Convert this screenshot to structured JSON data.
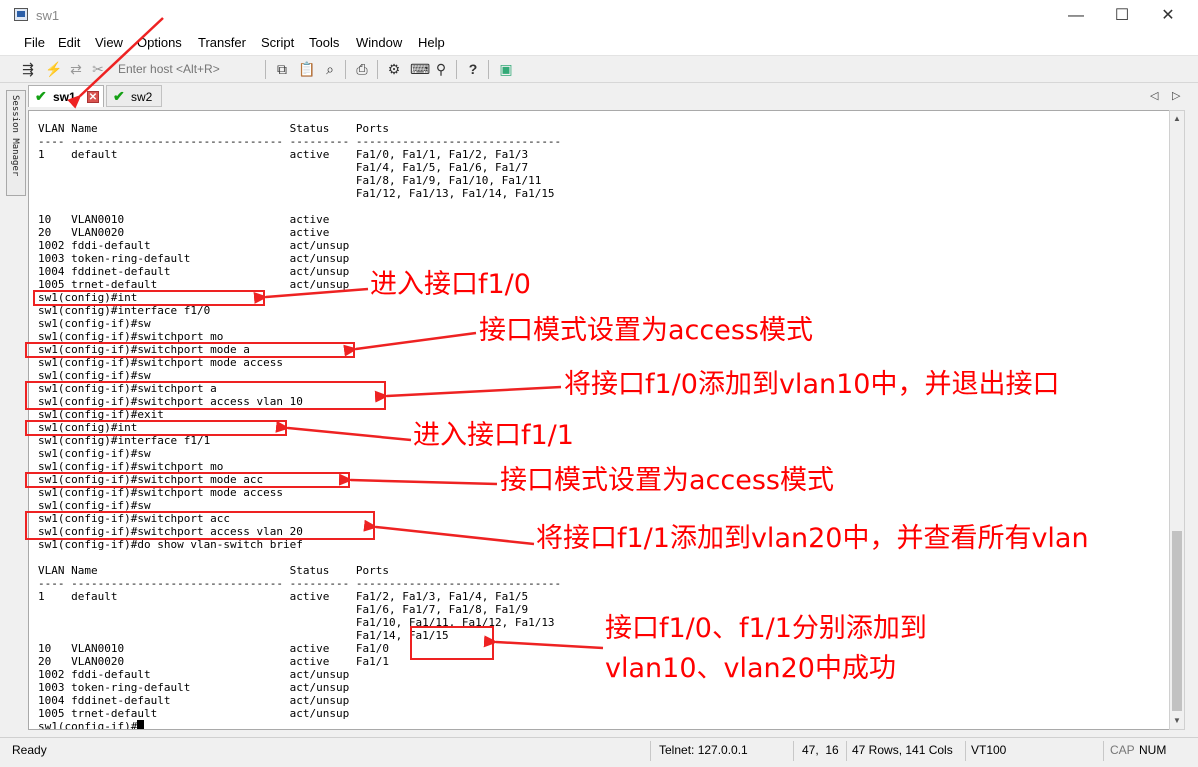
{
  "window": {
    "title": "sw1",
    "minimize": "—",
    "maximize": "☐",
    "close": "✕"
  },
  "menu": [
    "File",
    "Edit",
    "View",
    "Options",
    "Transfer",
    "Script",
    "Tools",
    "Window",
    "Help"
  ],
  "toolbar": {
    "host_placeholder": "Enter host <Alt+R>",
    "icons": [
      "connect-icon",
      "quick-connect-icon",
      "reconnect-icon",
      "disconnect-icon",
      "copy-icon",
      "paste-icon",
      "find-icon",
      "print-icon",
      "settings-icon",
      "keymap-icon",
      "sftp-icon",
      "help-icon",
      "log-icon"
    ]
  },
  "sidebar": {
    "label": "Session Manager"
  },
  "tabs": [
    {
      "label": "sw1",
      "active": true
    },
    {
      "label": "sw2",
      "active": false
    }
  ],
  "terminal": {
    "text": "VLAN Name                             Status    Ports\n---- -------------------------------- --------- -------------------------------\n1    default                          active    Fa1/0, Fa1/1, Fa1/2, Fa1/3\n                                                Fa1/4, Fa1/5, Fa1/6, Fa1/7\n                                                Fa1/8, Fa1/9, Fa1/10, Fa1/11\n                                                Fa1/12, Fa1/13, Fa1/14, Fa1/15\n\n10   VLAN0010                         active\n20   VLAN0020                         active\n1002 fddi-default                     act/unsup\n1003 token-ring-default               act/unsup\n1004 fddinet-default                  act/unsup\n1005 trnet-default                    act/unsup\nsw1(config)#int\nsw1(config)#interface f1/0\nsw1(config-if)#sw\nsw1(config-if)#switchport mo\nsw1(config-if)#switchport mode a\nsw1(config-if)#switchport mode access\nsw1(config-if)#sw\nsw1(config-if)#switchport a\nsw1(config-if)#switchport access vlan 10\nsw1(config-if)#exit\nsw1(config)#int\nsw1(config)#interface f1/1\nsw1(config-if)#sw\nsw1(config-if)#switchport mo\nsw1(config-if)#switchport mode acc\nsw1(config-if)#switchport mode access\nsw1(config-if)#sw\nsw1(config-if)#switchport acc\nsw1(config-if)#switchport access vlan 20\nsw1(config-if)#do show vlan-switch brief\n\nVLAN Name                             Status    Ports\n---- -------------------------------- --------- -------------------------------\n1    default                          active    Fa1/2, Fa1/3, Fa1/4, Fa1/5\n                                                Fa1/6, Fa1/7, Fa1/8, Fa1/9\n                                                Fa1/10, Fa1/11, Fa1/12, Fa1/13\n                                                Fa1/14, Fa1/15\n10   VLAN0010                         active    Fa1/0\n20   VLAN0020                         active    Fa1/1\n1002 fddi-default                     act/unsup\n1003 token-ring-default               act/unsup\n1004 fddinet-default                  act/unsup\n1005 trnet-default                    act/unsup\nsw1(config-if)#"
  },
  "status": {
    "ready": "Ready",
    "connection": "Telnet: 127.0.0.1",
    "position": "47,  16",
    "size": "47 Rows, 141 Cols",
    "emulation": "VT100",
    "cap": "CAP",
    "num": "NUM"
  },
  "annotations": {
    "a1": "进入接口f1/0",
    "a2": "接口模式设置为access模式",
    "a3": "将接口f1/0添加到vlan10中，并退出接口",
    "a4": "进入接口f1/1",
    "a5": "接口模式设置为access模式",
    "a6": "将接口f1/1添加到vlan20中，并查看所有vlan",
    "a7_line1": "接口f1/0、f1/1分别添加到",
    "a7_line2": "vlan10、vlan20中成功",
    "color": "#ff0000"
  }
}
